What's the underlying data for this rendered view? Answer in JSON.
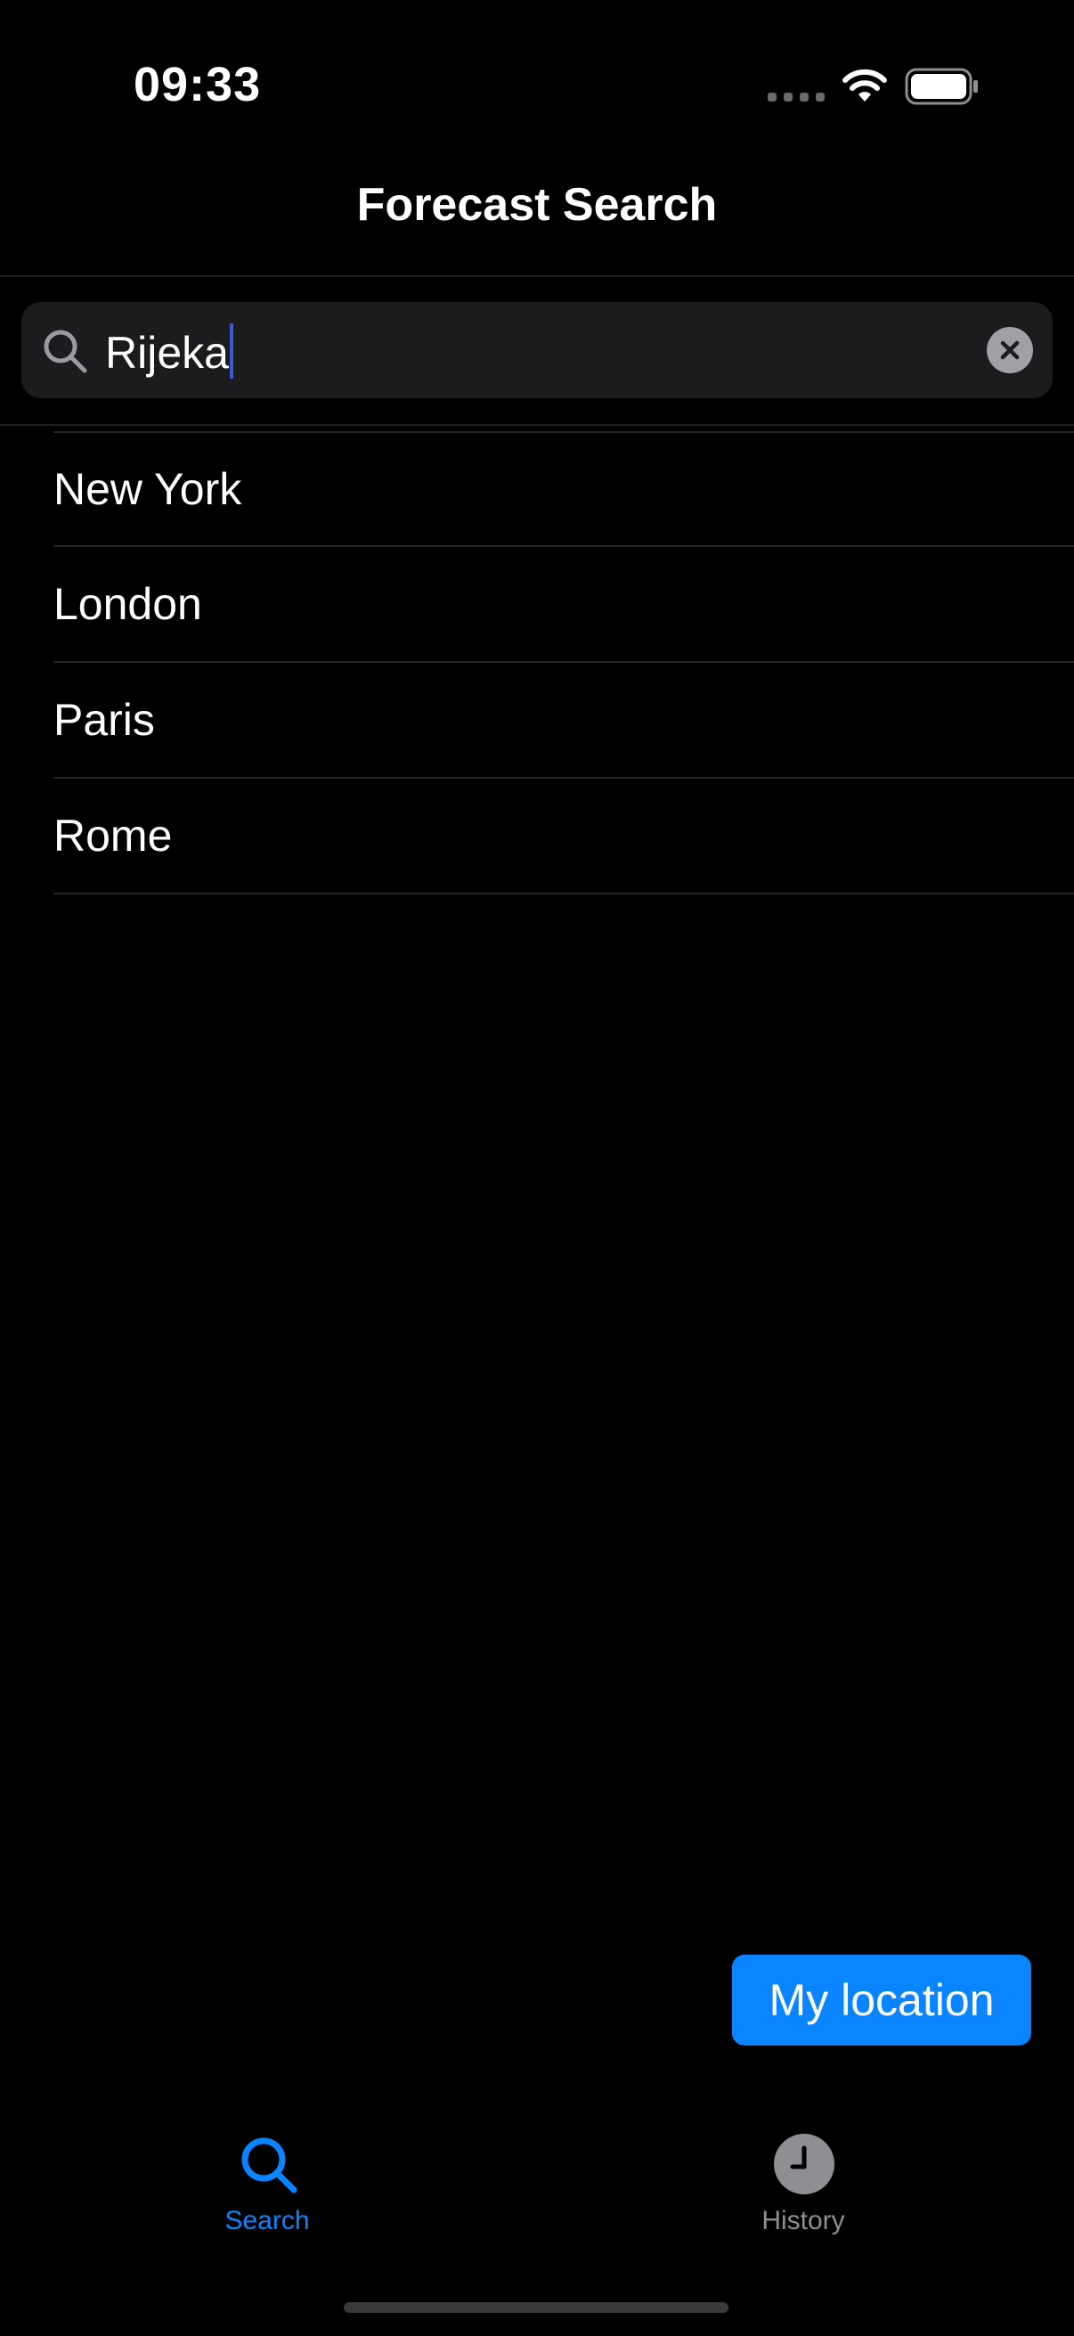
{
  "status_bar": {
    "time": "09:33",
    "icons": [
      "signal-icon",
      "wifi-icon",
      "battery-icon"
    ]
  },
  "nav": {
    "title": "Forecast Search"
  },
  "search": {
    "value": "Rijeka",
    "icon": "search-icon",
    "clear_icon": "clear-icon"
  },
  "cities": [
    {
      "label": "New York"
    },
    {
      "label": "London"
    },
    {
      "label": "Paris"
    },
    {
      "label": "Rome"
    }
  ],
  "location_button": {
    "label": "My location"
  },
  "tab_bar": {
    "tabs": [
      {
        "label": "Search",
        "icon": "search-icon",
        "selected": true
      },
      {
        "label": "History",
        "icon": "clock-icon",
        "selected": false
      }
    ]
  },
  "colors": {
    "background": "#000000",
    "accent": "#0a84ff",
    "field": "#1c1c1e",
    "inactive": "#8e8e93",
    "separator": "#262628"
  }
}
